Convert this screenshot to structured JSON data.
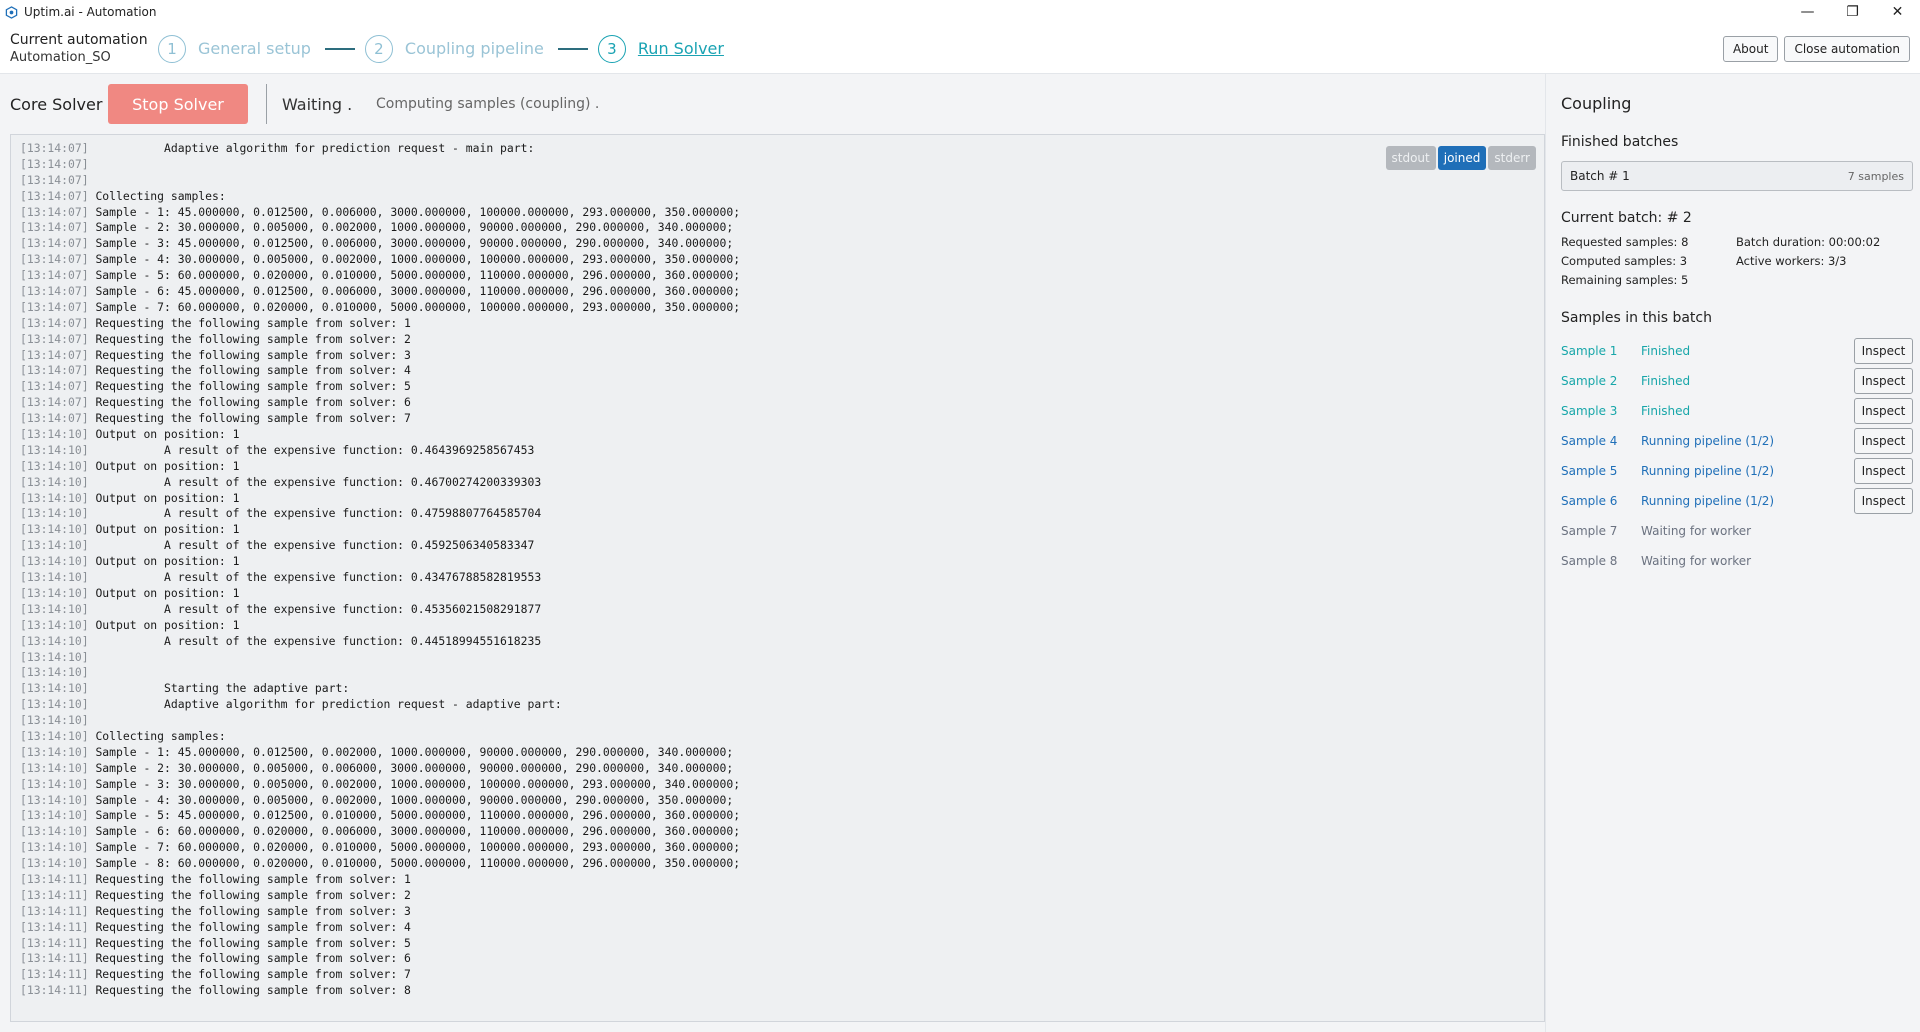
{
  "window": {
    "title": "Uptim.ai - Automation",
    "app_icon": "hexagon-app-icon",
    "controls": {
      "minimize": "—",
      "maximize": "❐",
      "close": "✕"
    }
  },
  "header": {
    "automation_label": "Current automation",
    "automation_name": "Automation_SO",
    "steps": [
      {
        "number": "1",
        "label": "General setup"
      },
      {
        "number": "2",
        "label": "Coupling pipeline"
      },
      {
        "number": "3",
        "label": "Run Solver"
      }
    ],
    "about_label": "About",
    "close_label": "Close automation"
  },
  "toolbar": {
    "solver_label": "Core Solver",
    "stop_label": "Stop Solver",
    "status": "Waiting .",
    "progress": "Computing samples (coupling) ."
  },
  "log": {
    "streams": [
      "stdout",
      "joined",
      "stderr"
    ],
    "active_stream": "joined",
    "lines": [
      [
        "[13:14:07]",
        "          Adaptive algorithm for prediction request - main part:"
      ],
      [
        "[13:14:07]",
        ""
      ],
      [
        "[13:14:07]",
        ""
      ],
      [
        "[13:14:07]",
        "Collecting samples:"
      ],
      [
        "[13:14:07]",
        "Sample - 1: 45.000000, 0.012500, 0.006000, 3000.000000, 100000.000000, 293.000000, 350.000000;"
      ],
      [
        "[13:14:07]",
        "Sample - 2: 30.000000, 0.005000, 0.002000, 1000.000000, 90000.000000, 290.000000, 340.000000;"
      ],
      [
        "[13:14:07]",
        "Sample - 3: 45.000000, 0.012500, 0.006000, 3000.000000, 90000.000000, 290.000000, 340.000000;"
      ],
      [
        "[13:14:07]",
        "Sample - 4: 30.000000, 0.005000, 0.002000, 1000.000000, 100000.000000, 293.000000, 350.000000;"
      ],
      [
        "[13:14:07]",
        "Sample - 5: 60.000000, 0.020000, 0.010000, 5000.000000, 110000.000000, 296.000000, 360.000000;"
      ],
      [
        "[13:14:07]",
        "Sample - 6: 45.000000, 0.012500, 0.006000, 3000.000000, 110000.000000, 296.000000, 360.000000;"
      ],
      [
        "[13:14:07]",
        "Sample - 7: 60.000000, 0.020000, 0.010000, 5000.000000, 100000.000000, 293.000000, 350.000000;"
      ],
      [
        "[13:14:07]",
        "Requesting the following sample from solver: 1"
      ],
      [
        "[13:14:07]",
        "Requesting the following sample from solver: 2"
      ],
      [
        "[13:14:07]",
        "Requesting the following sample from solver: 3"
      ],
      [
        "[13:14:07]",
        "Requesting the following sample from solver: 4"
      ],
      [
        "[13:14:07]",
        "Requesting the following sample from solver: 5"
      ],
      [
        "[13:14:07]",
        "Requesting the following sample from solver: 6"
      ],
      [
        "[13:14:07]",
        "Requesting the following sample from solver: 7"
      ],
      [
        "[13:14:10]",
        "Output on position: 1"
      ],
      [
        "[13:14:10]",
        "          A result of the expensive function: 0.4643969258567453"
      ],
      [
        "[13:14:10]",
        "Output on position: 1"
      ],
      [
        "[13:14:10]",
        "          A result of the expensive function: 0.46700274200339303"
      ],
      [
        "[13:14:10]",
        "Output on position: 1"
      ],
      [
        "[13:14:10]",
        "          A result of the expensive function: 0.47598807764585704"
      ],
      [
        "[13:14:10]",
        "Output on position: 1"
      ],
      [
        "[13:14:10]",
        "          A result of the expensive function: 0.4592506340583347"
      ],
      [
        "[13:14:10]",
        "Output on position: 1"
      ],
      [
        "[13:14:10]",
        "          A result of the expensive function: 0.43476788582819553"
      ],
      [
        "[13:14:10]",
        "Output on position: 1"
      ],
      [
        "[13:14:10]",
        "          A result of the expensive function: 0.45356021508291877"
      ],
      [
        "[13:14:10]",
        "Output on position: 1"
      ],
      [
        "[13:14:10]",
        "          A result of the expensive function: 0.44518994551618235"
      ],
      [
        "[13:14:10]",
        ""
      ],
      [
        "[13:14:10]",
        ""
      ],
      [
        "[13:14:10]",
        "          Starting the adaptive part:"
      ],
      [
        "[13:14:10]",
        "          Adaptive algorithm for prediction request - adaptive part:"
      ],
      [
        "[13:14:10]",
        ""
      ],
      [
        "[13:14:10]",
        "Collecting samples:"
      ],
      [
        "[13:14:10]",
        "Sample - 1: 45.000000, 0.012500, 0.002000, 1000.000000, 90000.000000, 290.000000, 340.000000;"
      ],
      [
        "[13:14:10]",
        "Sample - 2: 30.000000, 0.005000, 0.006000, 3000.000000, 90000.000000, 290.000000, 340.000000;"
      ],
      [
        "[13:14:10]",
        "Sample - 3: 30.000000, 0.005000, 0.002000, 1000.000000, 100000.000000, 293.000000, 340.000000;"
      ],
      [
        "[13:14:10]",
        "Sample - 4: 30.000000, 0.005000, 0.002000, 1000.000000, 90000.000000, 290.000000, 350.000000;"
      ],
      [
        "[13:14:10]",
        "Sample - 5: 45.000000, 0.012500, 0.010000, 5000.000000, 110000.000000, 296.000000, 360.000000;"
      ],
      [
        "[13:14:10]",
        "Sample - 6: 60.000000, 0.020000, 0.006000, 3000.000000, 110000.000000, 296.000000, 360.000000;"
      ],
      [
        "[13:14:10]",
        "Sample - 7: 60.000000, 0.020000, 0.010000, 5000.000000, 100000.000000, 293.000000, 360.000000;"
      ],
      [
        "[13:14:10]",
        "Sample - 8: 60.000000, 0.020000, 0.010000, 5000.000000, 110000.000000, 296.000000, 350.000000;"
      ],
      [
        "[13:14:11]",
        "Requesting the following sample from solver: 1"
      ],
      [
        "[13:14:11]",
        "Requesting the following sample from solver: 2"
      ],
      [
        "[13:14:11]",
        "Requesting the following sample from solver: 3"
      ],
      [
        "[13:14:11]",
        "Requesting the following sample from solver: 4"
      ],
      [
        "[13:14:11]",
        "Requesting the following sample from solver: 5"
      ],
      [
        "[13:14:11]",
        "Requesting the following sample from solver: 6"
      ],
      [
        "[13:14:11]",
        "Requesting the following sample from solver: 7"
      ],
      [
        "[13:14:11]",
        "Requesting the following sample from solver: 8"
      ]
    ]
  },
  "coupling": {
    "title": "Coupling",
    "finished_batches_label": "Finished batches",
    "batches": [
      {
        "name": "Batch # 1",
        "samples": "7 samples"
      }
    ],
    "current_batch_label": "Current batch: # 2",
    "stats": {
      "requested": "Requested samples: 8",
      "duration": "Batch duration: 00:00:02",
      "computed": "Computed samples: 3",
      "workers": "Active workers: 3/3",
      "remaining": "Remaining samples: 5"
    },
    "samples_label": "Samples in this batch",
    "inspect_label": "Inspect",
    "samples": [
      {
        "name": "Sample 1",
        "status": "Finished",
        "state": "finished"
      },
      {
        "name": "Sample 2",
        "status": "Finished",
        "state": "finished"
      },
      {
        "name": "Sample 3",
        "status": "Finished",
        "state": "finished"
      },
      {
        "name": "Sample 4",
        "status": "Running pipeline (1/2)",
        "state": "running"
      },
      {
        "name": "Sample 5",
        "status": "Running pipeline (1/2)",
        "state": "running"
      },
      {
        "name": "Sample 6",
        "status": "Running pipeline (1/2)",
        "state": "running"
      },
      {
        "name": "Sample 7",
        "status": "Waiting for worker",
        "state": "waiting"
      },
      {
        "name": "Sample 8",
        "status": "Waiting for worker",
        "state": "waiting"
      }
    ]
  },
  "colors": {
    "accent": "#1aa3b3",
    "step_inactive": "#9ac4d6",
    "stop_button": "#f08882",
    "finished": "#17a6a9",
    "running": "#1f6fb8",
    "waiting": "#6b7280"
  }
}
